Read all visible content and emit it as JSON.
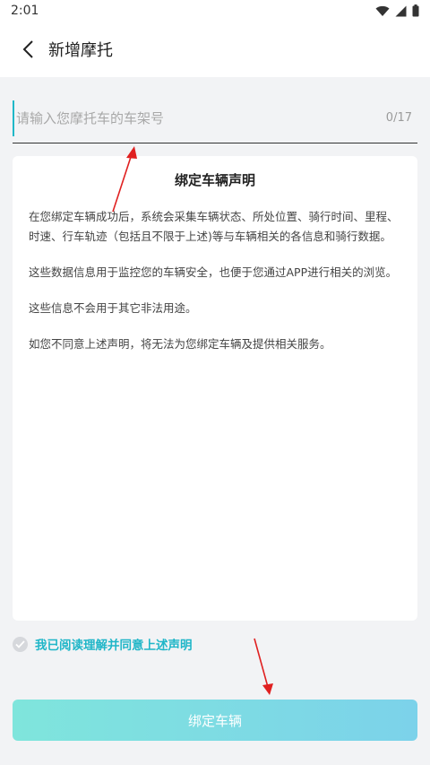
{
  "status_bar": {
    "time": "2:01"
  },
  "header": {
    "title": "新增摩托"
  },
  "vin_input": {
    "placeholder": "请输入您摩托车的车架号",
    "value": "",
    "counter": "0/17"
  },
  "statement": {
    "title": "绑定车辆声明",
    "paragraphs": [
      "在您绑定车辆成功后，系统会采集车辆状态、所处位置、骑行时间、里程、时速、行车轨迹（包括且不限于上述)等与车辆相关的各信息和骑行数据。",
      "这些数据信息用于监控您的车辆安全，也便于您通过APP进行相关的浏览。",
      "这些信息不会用于其它非法用途。",
      "如您不同意上述声明，将无法为您绑定车辆及提供相关服务。"
    ]
  },
  "agreement": {
    "label": "我已阅读理解并同意上述声明",
    "checked": false
  },
  "bind_button": {
    "label": "绑定车辆"
  },
  "colors": {
    "accent": "#20b6c8",
    "button_start": "#7fe5dc",
    "button_end": "#7cd2ea",
    "annotation_arrow": "#e02020"
  }
}
